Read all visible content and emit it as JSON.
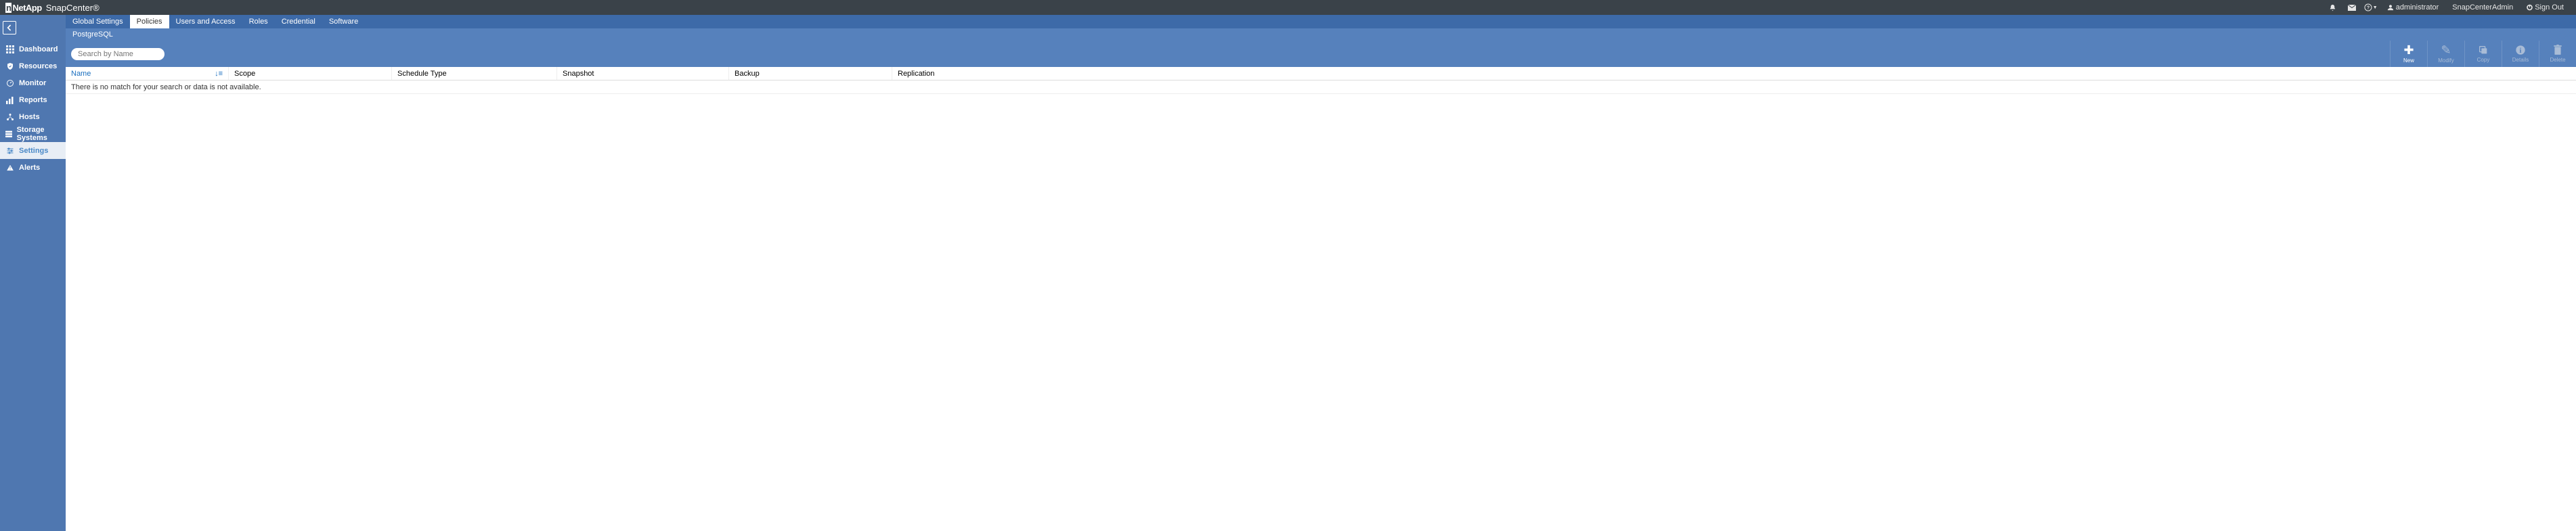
{
  "header": {
    "brand_prefix": "Net",
    "brand_suffix": "App",
    "product": "SnapCenter®",
    "user": "administrator",
    "role": "SnapCenterAdmin",
    "signout": "Sign Out"
  },
  "sidebar": {
    "items": [
      {
        "label": "Dashboard"
      },
      {
        "label": "Resources"
      },
      {
        "label": "Monitor"
      },
      {
        "label": "Reports"
      },
      {
        "label": "Hosts"
      },
      {
        "label": "Storage Systems"
      },
      {
        "label": "Settings"
      },
      {
        "label": "Alerts"
      }
    ]
  },
  "top_tabs": [
    {
      "label": "Global Settings"
    },
    {
      "label": "Policies"
    },
    {
      "label": "Users and Access"
    },
    {
      "label": "Roles"
    },
    {
      "label": "Credential"
    },
    {
      "label": "Software"
    }
  ],
  "sub_tabs": [
    {
      "label": "PostgreSQL"
    }
  ],
  "search": {
    "placeholder": "Search by Name"
  },
  "actions": {
    "new": "New",
    "modify": "Modify",
    "copy": "Copy",
    "details": "Details",
    "delete": "Delete"
  },
  "table": {
    "columns": {
      "name": "Name",
      "scope": "Scope",
      "schedule": "Schedule Type",
      "snapshot": "Snapshot",
      "backup": "Backup",
      "replication": "Replication"
    },
    "empty_message": "There is no match for your search or data is not available."
  }
}
